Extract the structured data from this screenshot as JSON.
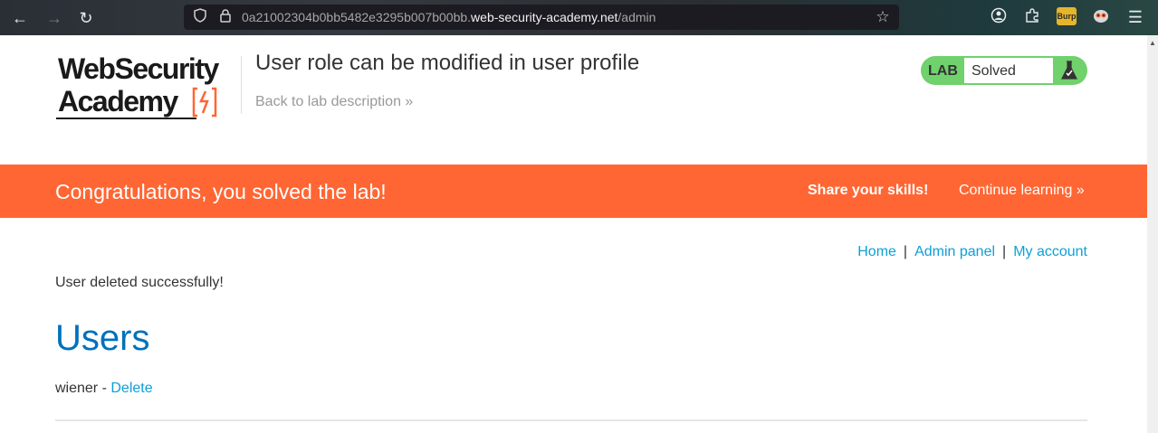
{
  "browser": {
    "url_prefix": "0a21002304b0bb5482e3295b007b00bb.",
    "url_host": "web-security-academy.net",
    "url_path": "/admin",
    "extension_badge": "Burp"
  },
  "header": {
    "logo_line1": "WebSecurity",
    "logo_line2": "Academy",
    "lab_title": "User role can be modified in user profile",
    "back_link": "Back to lab description »",
    "lab_tag": "LAB",
    "lab_status": "Solved"
  },
  "banner": {
    "message": "Congratulations, you solved the lab!",
    "share": "Share your skills!",
    "continue": "Continue learning »",
    "color": "#ff6633"
  },
  "nav": {
    "home": "Home",
    "admin_panel": "Admin panel",
    "my_account": "My account",
    "separator": "|"
  },
  "main": {
    "message": "User deleted successfully!",
    "heading": "Users",
    "users": [
      {
        "name": "wiener",
        "separator": " - ",
        "action": "Delete"
      }
    ]
  },
  "colors": {
    "link": "#0da0d6",
    "heading": "#0071bc",
    "lab_green": "#70d16d"
  }
}
